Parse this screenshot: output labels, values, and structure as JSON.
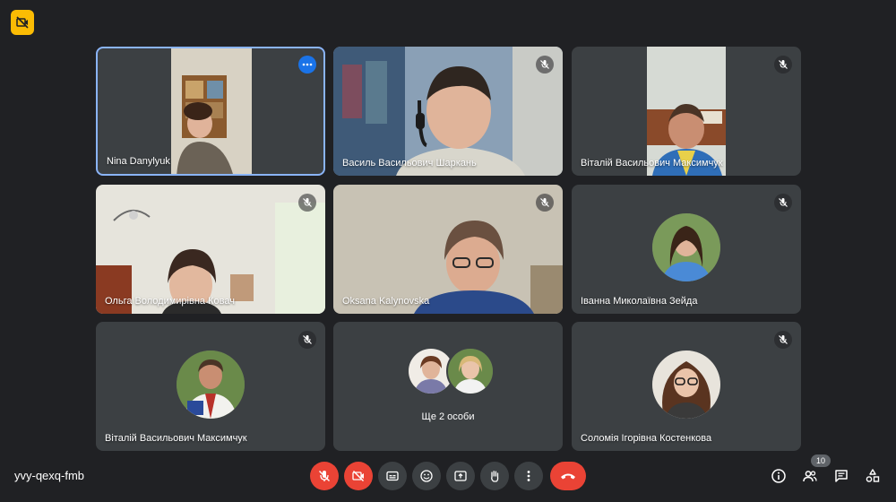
{
  "meeting": {
    "code": "yvy-qexq-fmb"
  },
  "participants_count": "10",
  "tiles": [
    {
      "name": "Nina Danylyuk"
    },
    {
      "name": "Василь Васильович Шаркань"
    },
    {
      "name": "Віталій Васильович Максимчук"
    },
    {
      "name": "Ольга Володимирівна Ковач"
    },
    {
      "name": "Oksana Kalynovska"
    },
    {
      "name": "Іванна Миколаївна Зейда"
    },
    {
      "name": "Віталій Васильович Максимчук"
    },
    {
      "name": "Ще 2 особи"
    },
    {
      "name": "Соломія Ігорівна Костенкова"
    }
  ],
  "colors": {
    "background": "#202124",
    "tile": "#3c4043",
    "active_border": "#8ab4f8",
    "danger": "#ea4335",
    "badge": "#fbbc04"
  }
}
